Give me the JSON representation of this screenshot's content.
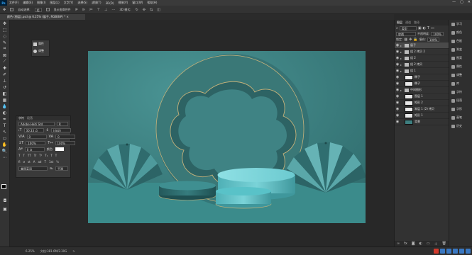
{
  "app": {
    "logo": "Ps"
  },
  "menu": [
    "文件(F)",
    "编辑(E)",
    "图像(I)",
    "图层(L)",
    "文字(Y)",
    "选择(S)",
    "滤镜(T)",
    "3D(D)",
    "视图(V)",
    "窗口(W)",
    "帮助(H)"
  ],
  "window_controls": {
    "minimize": "—",
    "maximize": "▢",
    "close": "✕"
  },
  "options": {
    "auto_select": "自动选择:",
    "target": "组",
    "show_transform": "显示变换控件",
    "mode3d": "3D 模式:"
  },
  "document": {
    "tab_title": "颜色 (图层),psd @ 6.25% (展子, RGB/8#) *",
    "close": "×"
  },
  "mini_panel": {
    "item1": "属性",
    "item2": "调整"
  },
  "character": {
    "tab1": "字符",
    "tab2": "段落",
    "font_family": "Adobe Heiti Std",
    "font_style": "R",
    "font_size": "30.33 点",
    "leading": "(自动)",
    "kerning": "0",
    "tracking": "0",
    "scale_v": "100%",
    "scale_h": "100%",
    "baseline": "0 点",
    "color_label": "颜色:",
    "language": "美国英语",
    "aa": "平滑",
    "styles": [
      "T",
      "T",
      "TT",
      "Tr",
      "T¹",
      "T₁",
      "T",
      "T"
    ],
    "features": [
      "fi",
      "σ",
      "st",
      "A",
      "ad",
      "T",
      "1st",
      "½"
    ]
  },
  "layers": {
    "tabs": [
      "图层",
      "通道",
      "路径"
    ],
    "filter_label": "类型",
    "blend_mode": "穿透",
    "opacity_label": "不透明度:",
    "opacity": "100%",
    "lock_label": "锁定:",
    "fill_label": "填充:",
    "fill": "100%",
    "items": [
      {
        "name": "展子",
        "type": "folder",
        "selected": true
      },
      {
        "name": "组 2 拷贝 2",
        "type": "folder"
      },
      {
        "name": "组 2",
        "type": "folder"
      },
      {
        "name": "组 2 拷贝",
        "type": "folder"
      },
      {
        "name": "组 1",
        "type": "folder"
      },
      {
        "name": "椭子",
        "type": "layer"
      },
      {
        "name": "椭子",
        "type": "layer"
      },
      {
        "name": "中间图形",
        "type": "folder"
      },
      {
        "name": "图层 1",
        "type": "layer"
      },
      {
        "name": "矩形 2",
        "type": "layer"
      },
      {
        "name": "渐层 1 (2) 拷贝",
        "type": "layer"
      },
      {
        "name": "矩形 1",
        "type": "layer"
      },
      {
        "name": "背景",
        "type": "bg"
      }
    ],
    "footer_icons": [
      "link-icon",
      "fx-icon",
      "mask-icon",
      "adjust-icon",
      "folder-icon",
      "new-layer-icon",
      "trash-icon"
    ]
  },
  "dock": [
    {
      "label": "学习",
      "icon": "learn-icon"
    },
    {
      "label": "颜色",
      "icon": "color-icon"
    },
    {
      "label": "色板",
      "icon": "swatches-icon"
    },
    {
      "label": "渐变",
      "icon": "gradient-icon"
    },
    {
      "label": "图案",
      "icon": "pattern-icon"
    },
    {
      "label": "属性",
      "icon": "properties-icon"
    },
    {
      "label": "调整",
      "icon": "adjust-icon"
    },
    {
      "label": "库",
      "icon": "library-icon"
    },
    {
      "label": "字符",
      "icon": "character-icon"
    },
    {
      "label": "段落",
      "icon": "paragraph-icon"
    },
    {
      "label": "字形",
      "icon": "glyphs-icon"
    },
    {
      "label": "画笔",
      "icon": "brush-icon"
    },
    {
      "label": "历史",
      "icon": "history-icon"
    }
  ],
  "status": {
    "zoom": "6.25%",
    "doc_info": "文档:381.6M/2.30G",
    "arrow": ">"
  },
  "colors": {
    "canvas": "#3e7f80",
    "canvas_dark": "#2f6465",
    "arch": "#35706f",
    "podium": "#6fc9cf",
    "podium_dark": "#2b6c6f",
    "gold": "#c6b27a",
    "floor": "#3b8b8b"
  }
}
